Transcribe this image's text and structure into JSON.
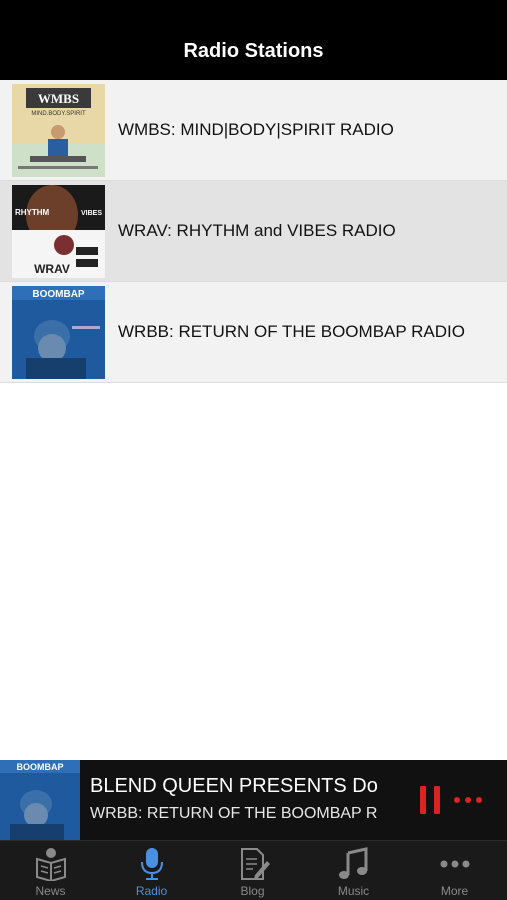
{
  "navbar": {
    "title": "Radio Stations"
  },
  "stations": [
    {
      "name": "WMBS: MIND|BODY|SPIRIT RADIO",
      "art_text": "WMBS",
      "art_subtext": "MIND.BODY.SPIRIT"
    },
    {
      "name": "WRAV: RHYTHM and VIBES RADIO",
      "art_text": "WRAV",
      "art_subtext": "RHYTHM",
      "art_subtext2": "VIBES"
    },
    {
      "name": "WRBB: RETURN OF THE BOOMBAP RADIO",
      "art_text": "BOOMBAP"
    }
  ],
  "player": {
    "track_title": "BLEND QUEEN PRESENTS Do",
    "station": "WRBB: RETURN OF THE BOOMBAP R",
    "art_text": "BOOMBAP"
  },
  "tabs": [
    {
      "label": "News",
      "icon": "newspaper-reader-icon"
    },
    {
      "label": "Radio",
      "icon": "microphone-icon",
      "active": true
    },
    {
      "label": "Blog",
      "icon": "document-pencil-icon"
    },
    {
      "label": "Music",
      "icon": "music-note-icon"
    },
    {
      "label": "More",
      "icon": "ellipsis-icon"
    }
  ],
  "colors": {
    "navbar_bg": "#000000",
    "player_accent": "#dd2222",
    "tab_active": "#4a90e2",
    "tab_inactive": "#8a8a8a"
  }
}
